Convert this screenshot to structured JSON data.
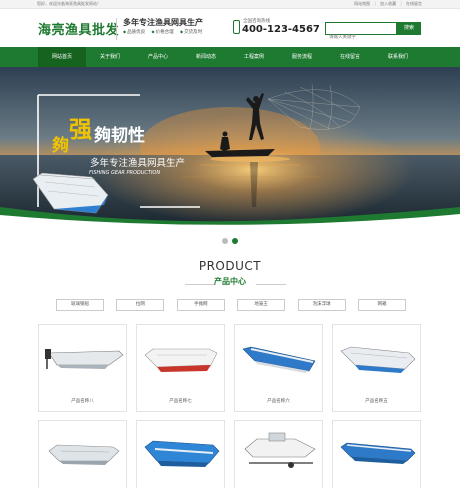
{
  "topbar": {
    "welcome": "您好，欢迎光临海亮渔具批发网站！",
    "links": [
      "网站地图",
      "加入收藏",
      "在线留言"
    ]
  },
  "header": {
    "logo": "海亮渔具批发",
    "slogan": "多年专注渔具网具生产",
    "features": [
      "品质优良",
      "价格合理",
      "交货及时"
    ],
    "phone_label": "全国咨询热线",
    "phone_number": "400-123-4567",
    "search_placeholder": "请输入关键字",
    "search_button": "搜索"
  },
  "nav": {
    "items": [
      "网站首页",
      "关于我们",
      "产品中心",
      "新闻动态",
      "工程案例",
      "服务流程",
      "在线留言",
      "联系我们"
    ],
    "active_index": 0
  },
  "banner": {
    "char1": "夠",
    "char2": "强",
    "chars_rest": "夠韧性",
    "subtitle": "多年专注渔具网具生产",
    "english": "FISHING GEAR PRODUCTION",
    "slide_count": 2,
    "active_slide": 1
  },
  "products": {
    "title_en": "PRODUCT",
    "title_cn": "产品中心",
    "categories": [
      "玻璃钢船",
      "拉网",
      "手抛网",
      "地笼王",
      "泡沫浮球",
      "网箱"
    ],
    "items": [
      {
        "name": "产品名称八"
      },
      {
        "name": "产品名称七"
      },
      {
        "name": "产品名称六"
      },
      {
        "name": "产品名称五"
      },
      {
        "name": ""
      },
      {
        "name": ""
      },
      {
        "name": ""
      },
      {
        "name": ""
      }
    ]
  },
  "colors": {
    "brand_green": "#1e7a30",
    "banner_gold": "#f0c400"
  }
}
